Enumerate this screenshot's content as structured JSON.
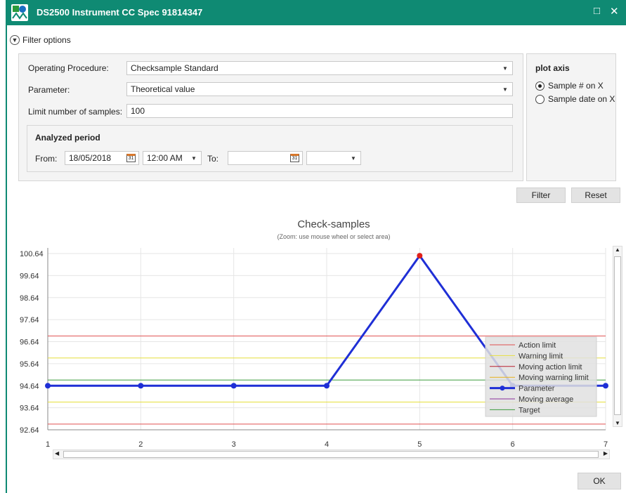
{
  "window": {
    "title": "DS2500 Instrument CC Spec 91814347",
    "maximize_icon": "maximize-icon",
    "close_icon": "close-icon",
    "accent_color": "#0f8a73"
  },
  "filter": {
    "toggle_label": "Filter options",
    "operating_procedure_label": "Operating Procedure:",
    "operating_procedure_value": "Checksample Standard",
    "parameter_label": "Parameter:",
    "parameter_value": "Theoretical value",
    "limit_label": "Limit number of samples:",
    "limit_value": "100",
    "period_title": "Analyzed period",
    "from_label": "From:",
    "from_date": "18/05/2018",
    "from_time": "12:00 AM",
    "to_label": "To:",
    "to_date": "",
    "to_time": "",
    "calendar_icon_text": "31",
    "filter_button": "Filter",
    "reset_button": "Reset"
  },
  "plot_axis": {
    "title": "plot axis",
    "options": [
      "Sample # on X",
      "Sample date on X"
    ],
    "selected": 0
  },
  "footer": {
    "ok_button": "OK"
  },
  "chart_data": {
    "type": "line",
    "title": "Check-samples",
    "subtitle": "(Zoom: use mouse wheel or select area)",
    "x": [
      1,
      2,
      3,
      4,
      5,
      6,
      7
    ],
    "xlim": [
      1,
      7
    ],
    "ylim": [
      92.64,
      100.64
    ],
    "y_ticks": [
      "100.64",
      "99.64",
      "98.64",
      "97.64",
      "96.64",
      "95.64",
      "94.64",
      "93.64",
      "92.64"
    ],
    "x_ticks": [
      "1",
      "2",
      "3",
      "4",
      "5",
      "6",
      "7"
    ],
    "grid": true,
    "legend_position": "right",
    "series": [
      {
        "name": "Parameter",
        "color": "#1f2fd6",
        "values": [
          94.64,
          94.64,
          94.64,
          94.64,
          100.54,
          94.64,
          94.64
        ]
      }
    ],
    "highlighted_point": {
      "x": 5,
      "y": 100.54,
      "color": "#e0201a"
    },
    "reference_lines": [
      {
        "name": "Action limit",
        "color": "#e05050",
        "values": [
          96.9,
          92.9
        ]
      },
      {
        "name": "Warning limit",
        "color": "#e6df3a",
        "values": [
          95.9,
          93.9
        ]
      },
      {
        "name": "Moving action limit",
        "color": "#b81e2e",
        "values": []
      },
      {
        "name": "Moving warning limit",
        "color": "#e6b21a",
        "values": []
      },
      {
        "name": "Moving average",
        "color": "#8a2f9a",
        "values": []
      },
      {
        "name": "Target",
        "color": "#3a9a3a",
        "values": [
          94.9
        ]
      }
    ],
    "legend": [
      {
        "name": "Action limit",
        "color": "#e05050",
        "marker": false
      },
      {
        "name": "Warning limit",
        "color": "#e6df3a",
        "marker": false
      },
      {
        "name": "Moving action limit",
        "color": "#b81e2e",
        "marker": false
      },
      {
        "name": "Moving warning limit",
        "color": "#e6b21a",
        "marker": false
      },
      {
        "name": "Parameter",
        "color": "#1f2fd6",
        "marker": true
      },
      {
        "name": "Moving average",
        "color": "#8a2f9a",
        "marker": false
      },
      {
        "name": "Target",
        "color": "#3a9a3a",
        "marker": false
      }
    ]
  }
}
